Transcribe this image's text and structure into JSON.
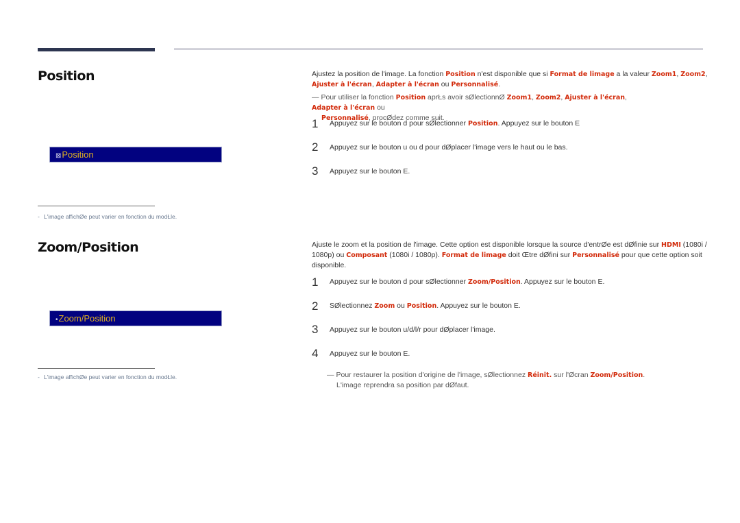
{
  "colors": {
    "highlight": "#d22a0a",
    "osd_background": "#020280",
    "osd_text": "#e0b020",
    "header_bar": "#2d3550"
  },
  "section1": {
    "title": "Position",
    "osd_label": "Position",
    "osd_icon": "position-icon",
    "footnote": "L'image affichØe peut varier en fonction du modŁle.",
    "intro": {
      "t1": "Ajustez la position de l'image. La fonction ",
      "h1": "Position",
      "t2": " n'est disponible que si ",
      "h2": "Format de limage",
      "t3": " a la valeur ",
      "h3": "Zoom1",
      "t4": ", ",
      "h4": "Zoom2",
      "t5": ", ",
      "h5": "Ajuster à l'écran",
      "t6": ", ",
      "h6": "Adapter à l'écran",
      "t7": " ou ",
      "h7": "Personnalisé",
      "t8": "."
    },
    "note": {
      "t1": "Pour utiliser la fonction ",
      "h1": "Position",
      "t2": " aprŁs avoir sØlectionnØ ",
      "h2": "Zoom1",
      "t3": ", ",
      "h3": "Zoom2",
      "t4": ", ",
      "h4": "Ajuster à l'écran",
      "t5": ", ",
      "h5": "Adapter à l'écran",
      "t6": " ou ",
      "h6": "Personnalisé",
      "t7": ", procØdez comme suit."
    },
    "steps": [
      {
        "num": "1",
        "t1": "Appuyez sur le bouton d pour sØlectionner ",
        "h1": "Position",
        "t2": ". Appuyez sur le bouton E"
      },
      {
        "num": "2",
        "t1": "Appuyez sur le bouton u ou d pour dØplacer l'image vers le haut ou le bas."
      },
      {
        "num": "3",
        "t1": "Appuyez sur le bouton E."
      }
    ]
  },
  "section2": {
    "title": "Zoom/Position",
    "osd_label": "Zoom/Position",
    "osd_icon": "bullet-icon",
    "footnote": "L'image affichØe peut varier en fonction du modŁle.",
    "intro": {
      "t1": "Ajuste le zoom et la position de l'image. Cette option est disponible lorsque la source d'entrØe est dØfinie sur ",
      "h1": "HDMI",
      "t2": " (1080i / 1080p) ou ",
      "h2": "Composant",
      "t3": " (1080i / 1080p). ",
      "h3": "Format de limage",
      "t4": " doit Œtre dØfini sur ",
      "h4": "Personnalisé",
      "t5": " pour que cette option soit disponible."
    },
    "steps": [
      {
        "num": "1",
        "t1": "Appuyez sur le bouton d pour sØlectionner ",
        "h1": "Zoom/Position",
        "t2": ". Appuyez sur le bouton E."
      },
      {
        "num": "2",
        "t1": "SØlectionnez ",
        "h1": "Zoom",
        "t2": " ou ",
        "h2": "Position",
        "t3": ". Appuyez sur le bouton E."
      },
      {
        "num": "3",
        "t1": "Appuyez sur le bouton u/d/l/r pour dØplacer l'image."
      },
      {
        "num": "4",
        "t1": "Appuyez sur le bouton E."
      }
    ],
    "note": {
      "t1": "Pour restaurer la position d'origine de l'image, sØlectionnez ",
      "h1": "Réinit.",
      "t2": " sur l'Øcran ",
      "h2": "Zoom/Position",
      "t3": ".",
      "line2": "L'image reprendra sa position par dØfaut."
    }
  }
}
